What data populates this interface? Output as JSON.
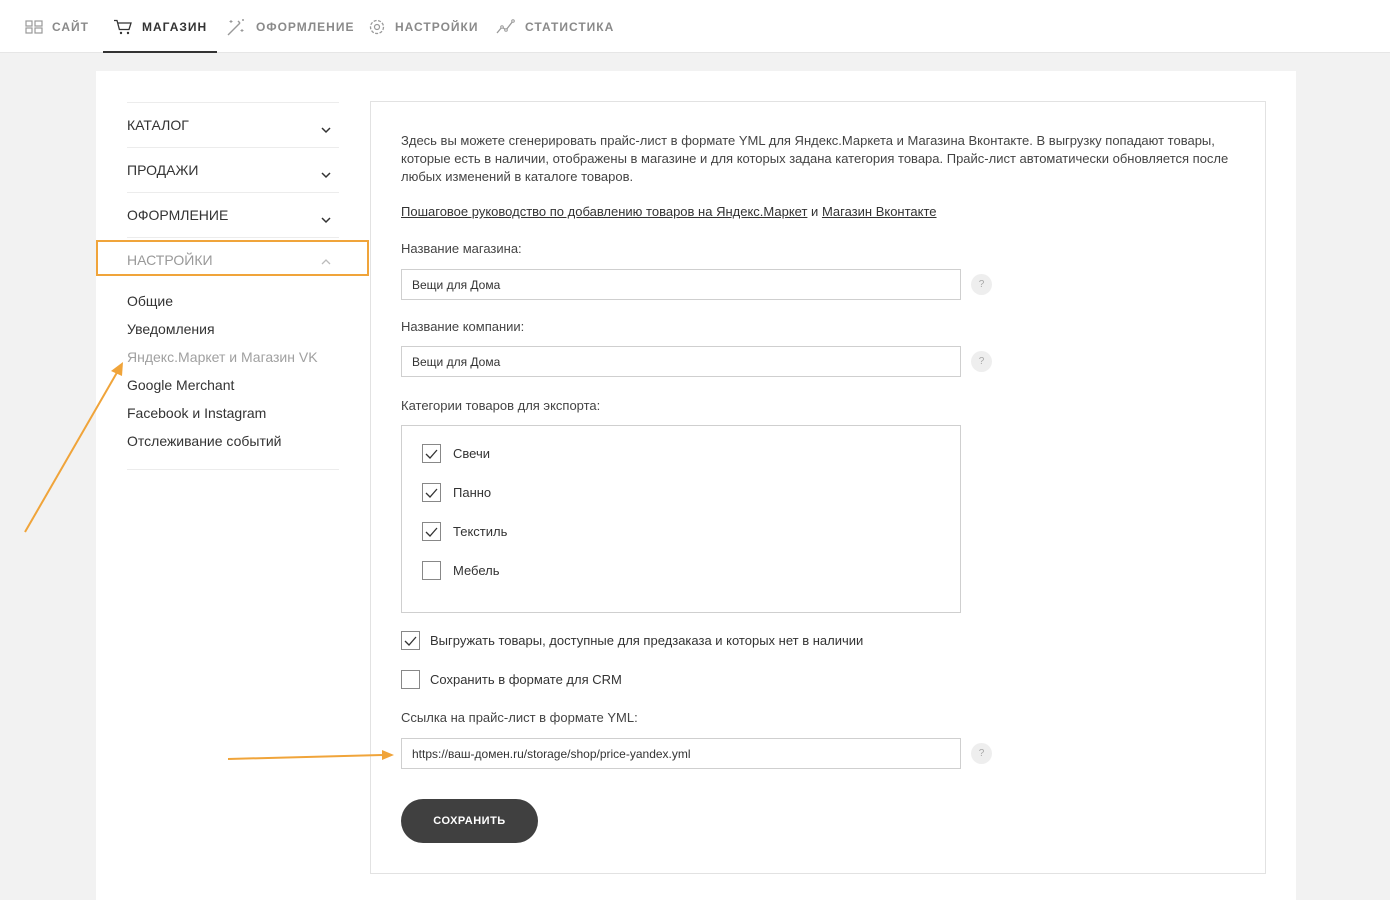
{
  "nav": {
    "tabs": [
      {
        "label": "САЙТ",
        "icon": "grid-icon"
      },
      {
        "label": "МАГАЗИН",
        "icon": "cart-icon",
        "active": true
      },
      {
        "label": "ОФОРМЛЕНИЕ",
        "icon": "magic-wand-icon"
      },
      {
        "label": "НАСТРОЙКИ",
        "icon": "gear-icon"
      },
      {
        "label": "СТАТИСТИКА",
        "icon": "chart-line-icon"
      }
    ]
  },
  "sidebar": {
    "sections": [
      {
        "label": "КАТАЛОГ",
        "expanded": false
      },
      {
        "label": "ПРОДАЖИ",
        "expanded": false
      },
      {
        "label": "ОФОРМЛЕНИЕ",
        "expanded": false
      },
      {
        "label": "НАСТРОЙКИ",
        "expanded": true
      }
    ],
    "settings_items": [
      "Общие",
      "Уведомления",
      "Яндекс.Маркет и Магазин VK",
      "Google Merchant",
      "Facebook и Instagram",
      "Отслеживание событий"
    ],
    "current_item": "Яндекс.Маркет и Магазин VK"
  },
  "content": {
    "intro": "Здесь вы можете сгенерировать прайс-лист в формате YML для Яндекс.Маркета и Магазина Вконтакте. В выгрузку попадают товары, которые есть в наличии, отображены в магазине и для которых задана категория товара. Прайс-лист автоматически обновляется после любых изменений в каталоге товаров.",
    "guide_link_1": "Пошаговое руководство по добавлению товаров на Яндекс.Маркет",
    "guide_and": "и",
    "guide_link_2": "Магазин Вконтакте",
    "shop_name_label": "Название магазина:",
    "shop_name_value": "Вещи для Дома",
    "company_name_label": "Название компании:",
    "company_name_value": "Вещи для Дома",
    "categories_label": "Категории товаров для экспорта:",
    "categories": [
      {
        "label": "Свечи",
        "checked": true
      },
      {
        "label": "Панно",
        "checked": true
      },
      {
        "label": "Текстиль",
        "checked": true
      },
      {
        "label": "Мебель",
        "checked": false
      }
    ],
    "preorder_label": "Выгружать товары, доступные для предзаказа и которых нет в наличии",
    "preorder_checked": true,
    "crm_label": "Сохранить в формате для CRM",
    "crm_checked": false,
    "yml_link_label": "Ссылка на прайс-лист в формате YML:",
    "yml_link_value": "https://ваш-домен.ru/storage/shop/price-yandex.yml",
    "help_glyph": "?",
    "save_label": "СОХРАНИТЬ"
  },
  "colors": {
    "highlight": "#f0a43a",
    "button": "#404040",
    "background": "#f2f2f2"
  }
}
